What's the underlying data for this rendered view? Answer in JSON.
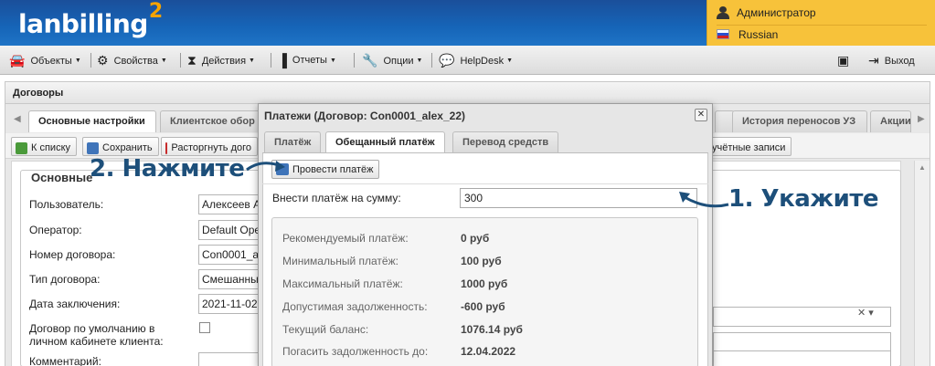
{
  "header": {
    "logo_text": "lanbilling",
    "logo_sup": "2",
    "user_name": "Администратор",
    "language": "Russian"
  },
  "menu": {
    "items": [
      {
        "label": "Объекты",
        "icon": "car-icon"
      },
      {
        "label": "Свойства",
        "icon": "gear-icon"
      },
      {
        "label": "Действия",
        "icon": "hourglass-icon"
      },
      {
        "label": "Отчеты",
        "icon": "bar-chart-icon"
      },
      {
        "label": "Опции",
        "icon": "wrench-icon"
      },
      {
        "label": "HelpDesk",
        "icon": "chat-icon"
      }
    ],
    "exit_label": "Выход"
  },
  "panel": {
    "title": "Договоры",
    "tabs": [
      "Основные настройки",
      "Клиентское обор",
      "История переносов УЗ",
      "Акции"
    ],
    "toolbar": {
      "to_list": "К списку",
      "save": "Сохранить",
      "terminate": "Расторгнуть дого",
      "accounts": "учётные записи"
    },
    "section_title": "Основные",
    "fields": [
      {
        "label": "Пользователь:",
        "value": "Алексеев А"
      },
      {
        "label": "Оператор:",
        "value": "Default Ope"
      },
      {
        "label": "Номер договора:",
        "value": "Con0001_a"
      },
      {
        "label": "Тип договора:",
        "value": "Смешанны"
      },
      {
        "label": "Дата заключения:",
        "value": "2021-11-02"
      }
    ],
    "default_contract_label_1": "Договор по умолчанию в",
    "default_contract_label_2": "личном кабинете клиента:",
    "comment_label": "Комментарий:"
  },
  "modal": {
    "title": "Платежи (Договор: Con0001_alex_22)",
    "close": "✕",
    "tabs": [
      "Платёж",
      "Обещанный платёж",
      "Перевод средств"
    ],
    "pay_button": "Провести платёж",
    "amount_label": "Внести платёж на сумму:",
    "amount_value": "300",
    "info": [
      {
        "label": "Рекомендуемый платёж:",
        "value": "0 руб"
      },
      {
        "label": "Минимальный платёж:",
        "value": "100 руб"
      },
      {
        "label": "Максимальный платёж:",
        "value": "1000 руб"
      },
      {
        "label": "Допустимая задолженность:",
        "value": "-600 руб"
      },
      {
        "label": "Текущий баланс:",
        "value": "1076.14 руб"
      },
      {
        "label": "Погасить задолженность до:",
        "value": "12.04.2022"
      }
    ]
  },
  "annotations": {
    "step1": "1. Укажите",
    "step2": "2. Нажмите"
  }
}
